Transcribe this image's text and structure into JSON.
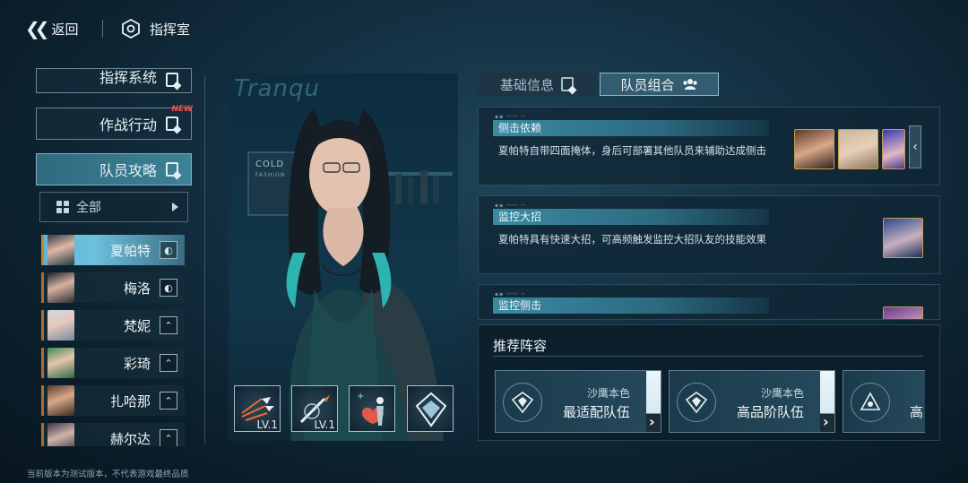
{
  "header": {
    "back_label": "返回",
    "title": "指挥室"
  },
  "menu": {
    "items": [
      {
        "label": "指挥系统",
        "partial": true
      },
      {
        "label": "作战行动",
        "badge": "NEW"
      },
      {
        "label": "队员攻略",
        "active": true
      }
    ],
    "filter_label": "全部"
  },
  "characters": [
    {
      "name": "夏帕特",
      "selected": true,
      "role_icon": "shield-icon"
    },
    {
      "name": "梅洛",
      "role_icon": "shield-icon"
    },
    {
      "name": "梵妮",
      "role_icon": "chevron-up-icon"
    },
    {
      "name": "彩琦",
      "role_icon": "chevron-up-icon"
    },
    {
      "name": "扎哈那",
      "role_icon": "chevron-up-icon"
    },
    {
      "name": "赫尔达",
      "role_icon": "chevron-up-icon"
    }
  ],
  "portrait": {
    "sign_text": "Tranqu",
    "poster_text_1": "COLD",
    "poster_text_2": "FASHION"
  },
  "skills": [
    {
      "icon": "arrows-skill-icon",
      "level": "LV.1"
    },
    {
      "icon": "lance-skill-icon",
      "level": "LV.1"
    },
    {
      "icon": "support-skill-icon",
      "level": ""
    },
    {
      "icon": "emblem-skill-icon",
      "level": ""
    }
  ],
  "tabs": {
    "basic_info": "基础信息",
    "team_combo": "队员组合"
  },
  "combos": [
    {
      "title": "侧击依赖",
      "desc": "夏帕特自带四面掩体，身后可部署其他队员来辅助达成侧击"
    },
    {
      "title": "监控大招",
      "desc": "夏帕特具有快速大招，可高频触发监控大招队友的技能效果"
    },
    {
      "title": "监控侧击",
      "desc": ""
    }
  ],
  "recommend": {
    "title": "推荐阵容",
    "cards": [
      {
        "sub": "沙鹰本色",
        "main": "最适配队伍"
      },
      {
        "sub": "沙鹰本色",
        "main": "高品阶队伍"
      },
      {
        "sub": "",
        "main": "高"
      }
    ]
  },
  "footer_note": "当前版本为测试版本，不代表游戏最终品质",
  "colors": {
    "accent": "#3d8296",
    "badge_new": "#ff4d4d",
    "background": "#143244"
  }
}
